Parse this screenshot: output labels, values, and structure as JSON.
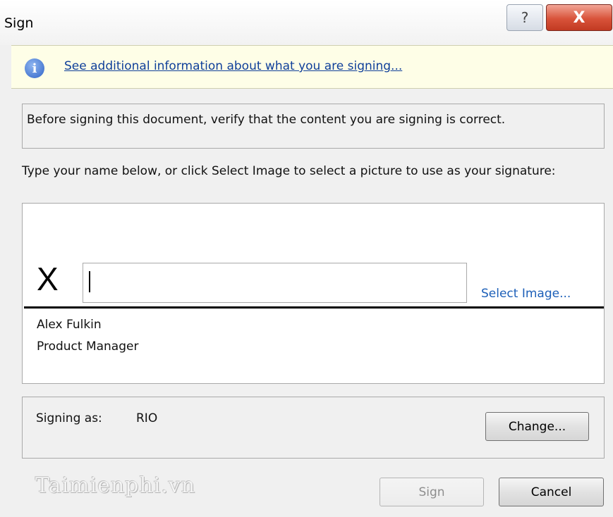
{
  "window": {
    "title": "Sign",
    "help_glyph": "?",
    "close_glyph": "X"
  },
  "infobar": {
    "icon": "info-icon",
    "icon_glyph": "i",
    "link": "See additional information about what you are signing..."
  },
  "verify": {
    "text": "Before signing this document, verify that the content you are signing is correct."
  },
  "prompt": {
    "text": "Type your name below, or click Select Image to select a picture to use as your signature:"
  },
  "signature": {
    "x_mark": "X",
    "input_value": "",
    "select_image_link": "Select Image...",
    "signer_name": "Alex Fulkin",
    "signer_title": "Product Manager"
  },
  "signing_as": {
    "label": "Signing as:",
    "value": "RIO",
    "change_button": "Change..."
  },
  "buttons": {
    "sign": "Sign",
    "cancel": "Cancel"
  },
  "watermark": "Taimienphi.vn",
  "colors": {
    "infobar_bg": "#fefee7",
    "link": "#0f3f9a",
    "close_button": "#d8533a"
  }
}
